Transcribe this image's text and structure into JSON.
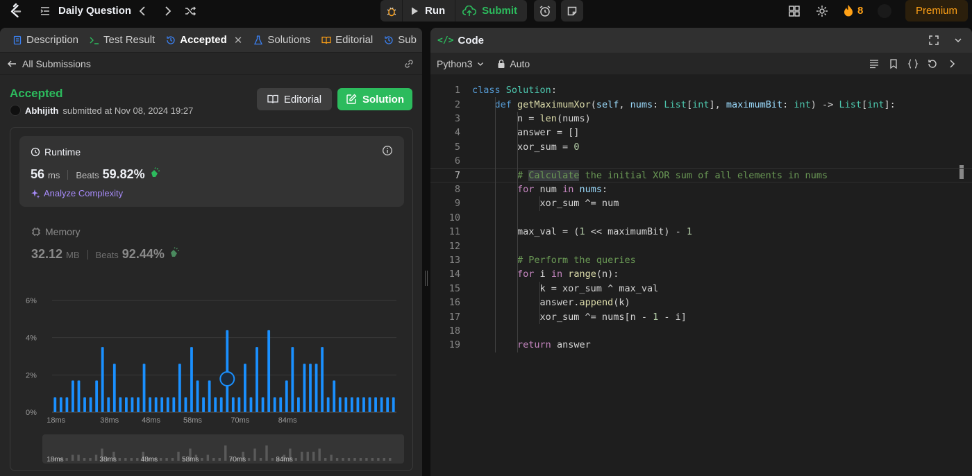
{
  "topbar": {
    "title": "Daily Question",
    "run_label": "Run",
    "submit_label": "Submit",
    "streak": "8",
    "premium_label": "Premium"
  },
  "left_tabs": [
    {
      "label": "Description"
    },
    {
      "label": "Test Result"
    },
    {
      "label": "Accepted"
    },
    {
      "label": "Solutions"
    },
    {
      "label": "Editorial"
    },
    {
      "label": "Sub"
    }
  ],
  "subbar": {
    "label": "All Submissions"
  },
  "result": {
    "status": "Accepted",
    "user": "Abhijith",
    "submitted_text": "submitted at Nov 08, 2024 19:27",
    "editorial_btn": "Editorial",
    "solution_btn": "Solution"
  },
  "runtime": {
    "title": "Runtime",
    "value": "56",
    "unit": "ms",
    "beats_label": "Beats",
    "beats": "59.82%",
    "analyze": "Analyze Complexity"
  },
  "memory": {
    "title": "Memory",
    "value": "32.12",
    "unit": "MB",
    "beats_label": "Beats",
    "beats": "92.44%"
  },
  "chart_data": {
    "type": "bar",
    "yticks": [
      "6%",
      "4%",
      "2%",
      "0%"
    ],
    "ylim": [
      0,
      6
    ],
    "xticks": [
      "18ms",
      "38ms",
      "48ms",
      "58ms",
      "70ms",
      "84ms"
    ],
    "grid": true,
    "values": [
      0.8,
      0.8,
      0.8,
      1.7,
      1.7,
      0.8,
      0.8,
      1.7,
      3.5,
      0.8,
      2.6,
      0.8,
      0.8,
      0.8,
      0.8,
      2.6,
      0.8,
      0.8,
      0.8,
      0.8,
      0.8,
      2.6,
      0.8,
      3.5,
      1.7,
      0.8,
      1.7,
      0.8,
      0.8,
      4.4,
      0.8,
      0.8,
      2.6,
      0.8,
      3.5,
      0.8,
      4.4,
      0.8,
      0.8,
      1.7,
      3.5,
      0.8,
      2.6,
      2.6,
      2.6,
      3.5,
      0.8,
      1.7,
      0.8,
      0.8,
      0.8,
      0.8,
      0.8,
      0.8,
      0.8,
      0.8,
      0.8,
      0.8
    ],
    "highlight_index": 29,
    "bar_color": "#1a90ff",
    "minimap_color": "#5a5a5a"
  },
  "code_panel": {
    "title": "Code",
    "language": "Python3",
    "mode": "Auto",
    "current_line": 7,
    "lines": [
      "class Solution:",
      "    def getMaximumXor(self, nums: List[int], maximumBit: int) -> List[int]:",
      "        n = len(nums)",
      "        answer = []",
      "        xor_sum = 0",
      "",
      "        # Calculate the initial XOR sum of all elements in nums",
      "        for num in nums:",
      "            xor_sum ^= num",
      "",
      "        max_val = (1 << maximumBit) - 1",
      "",
      "        # Perform the queries",
      "        for i in range(n):",
      "            k = xor_sum ^ max_val",
      "            answer.append(k)",
      "            xor_sum ^= nums[n - 1 - i]",
      "",
      "        return answer"
    ]
  },
  "colors": {
    "accent_green": "#2cbb5d",
    "accent_orange": "#ffa116",
    "bar_blue": "#1a90ff",
    "purple": "#a78bfa"
  }
}
